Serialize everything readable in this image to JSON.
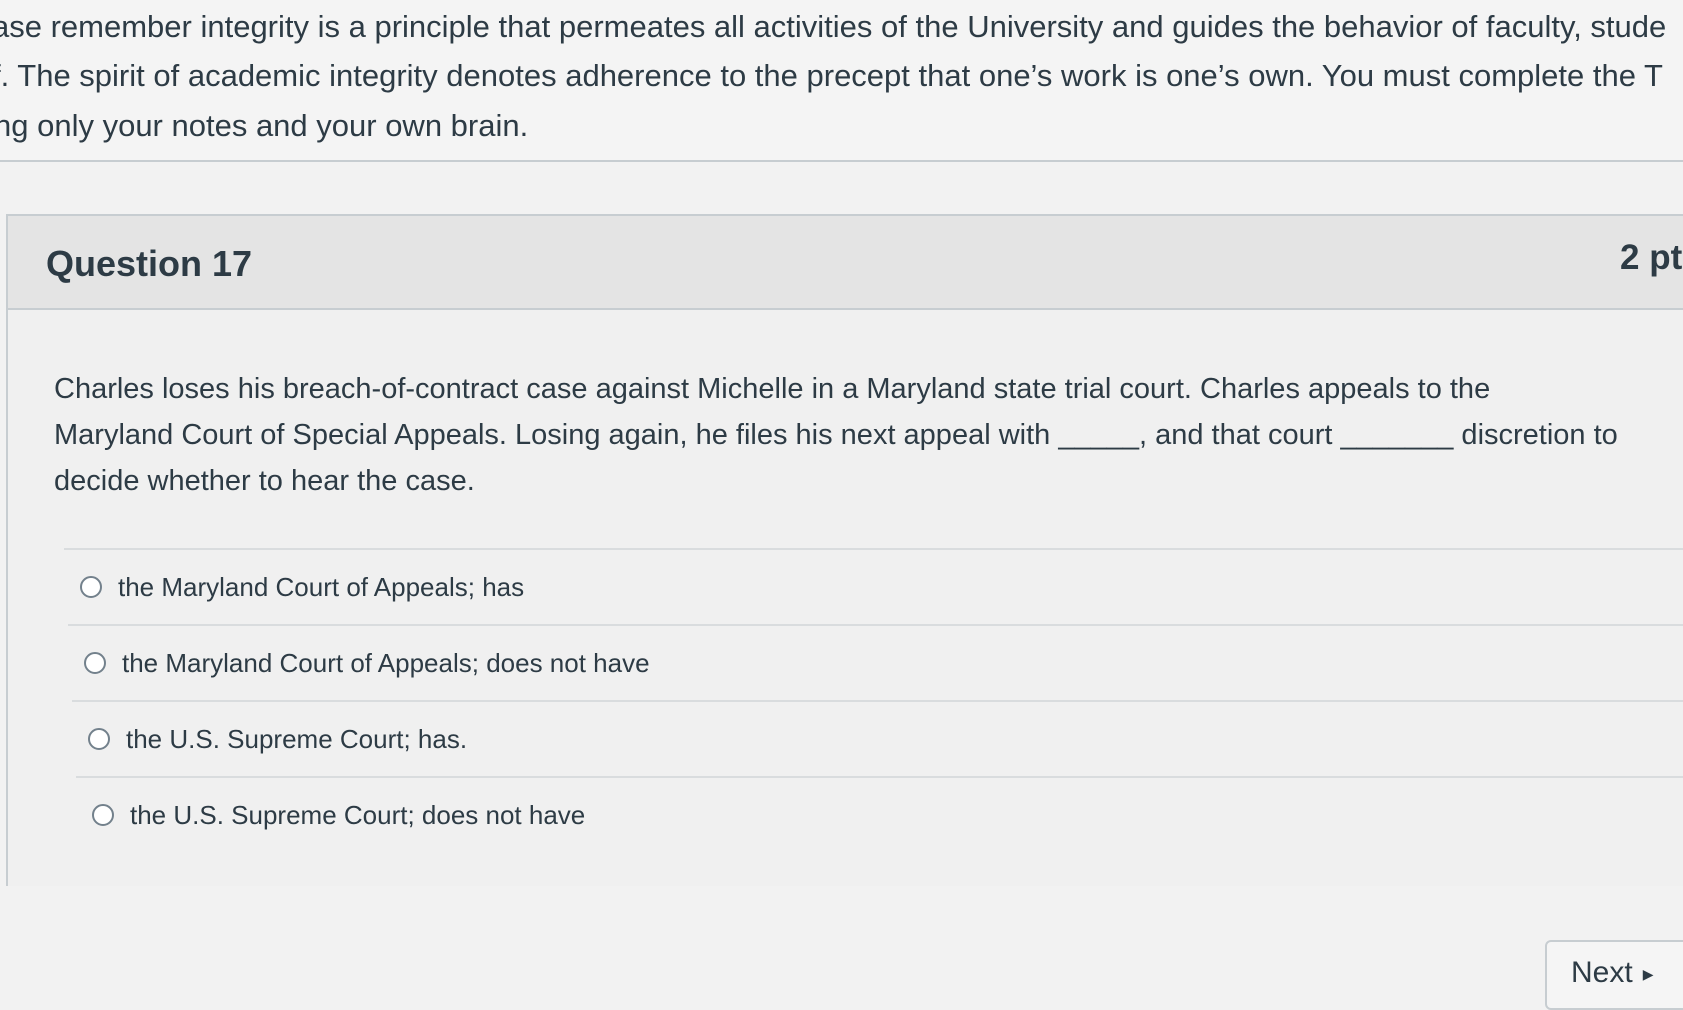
{
  "notice": {
    "line1": "ase remember integrity is a principle that permeates all activities of the University and guides the behavior of faculty, stude",
    "line2": "f. The spirit of academic integrity denotes adherence to the precept that one’s work is one’s own. You must complete the T",
    "line3": "ng only your notes and your own brain."
  },
  "question": {
    "title": "Question 17",
    "points": "2 pt",
    "text_lines": [
      "Charles loses his breach-of-contract case against Michelle in a Maryland state trial court. Charles appeals to the",
      "Maryland Court of Special Appeals. Losing again, he files his next appeal with _____, and that court _______ discretion to",
      "decide whether to hear the case."
    ],
    "answers": [
      "the Maryland Court of Appeals; has",
      "the Maryland Court of Appeals; does not have",
      "the U.S. Supreme Court; has.",
      "the U.S. Supreme Court; does not have"
    ]
  },
  "navigation": {
    "next_label": "Next",
    "next_icon": "triangle-right-icon"
  }
}
